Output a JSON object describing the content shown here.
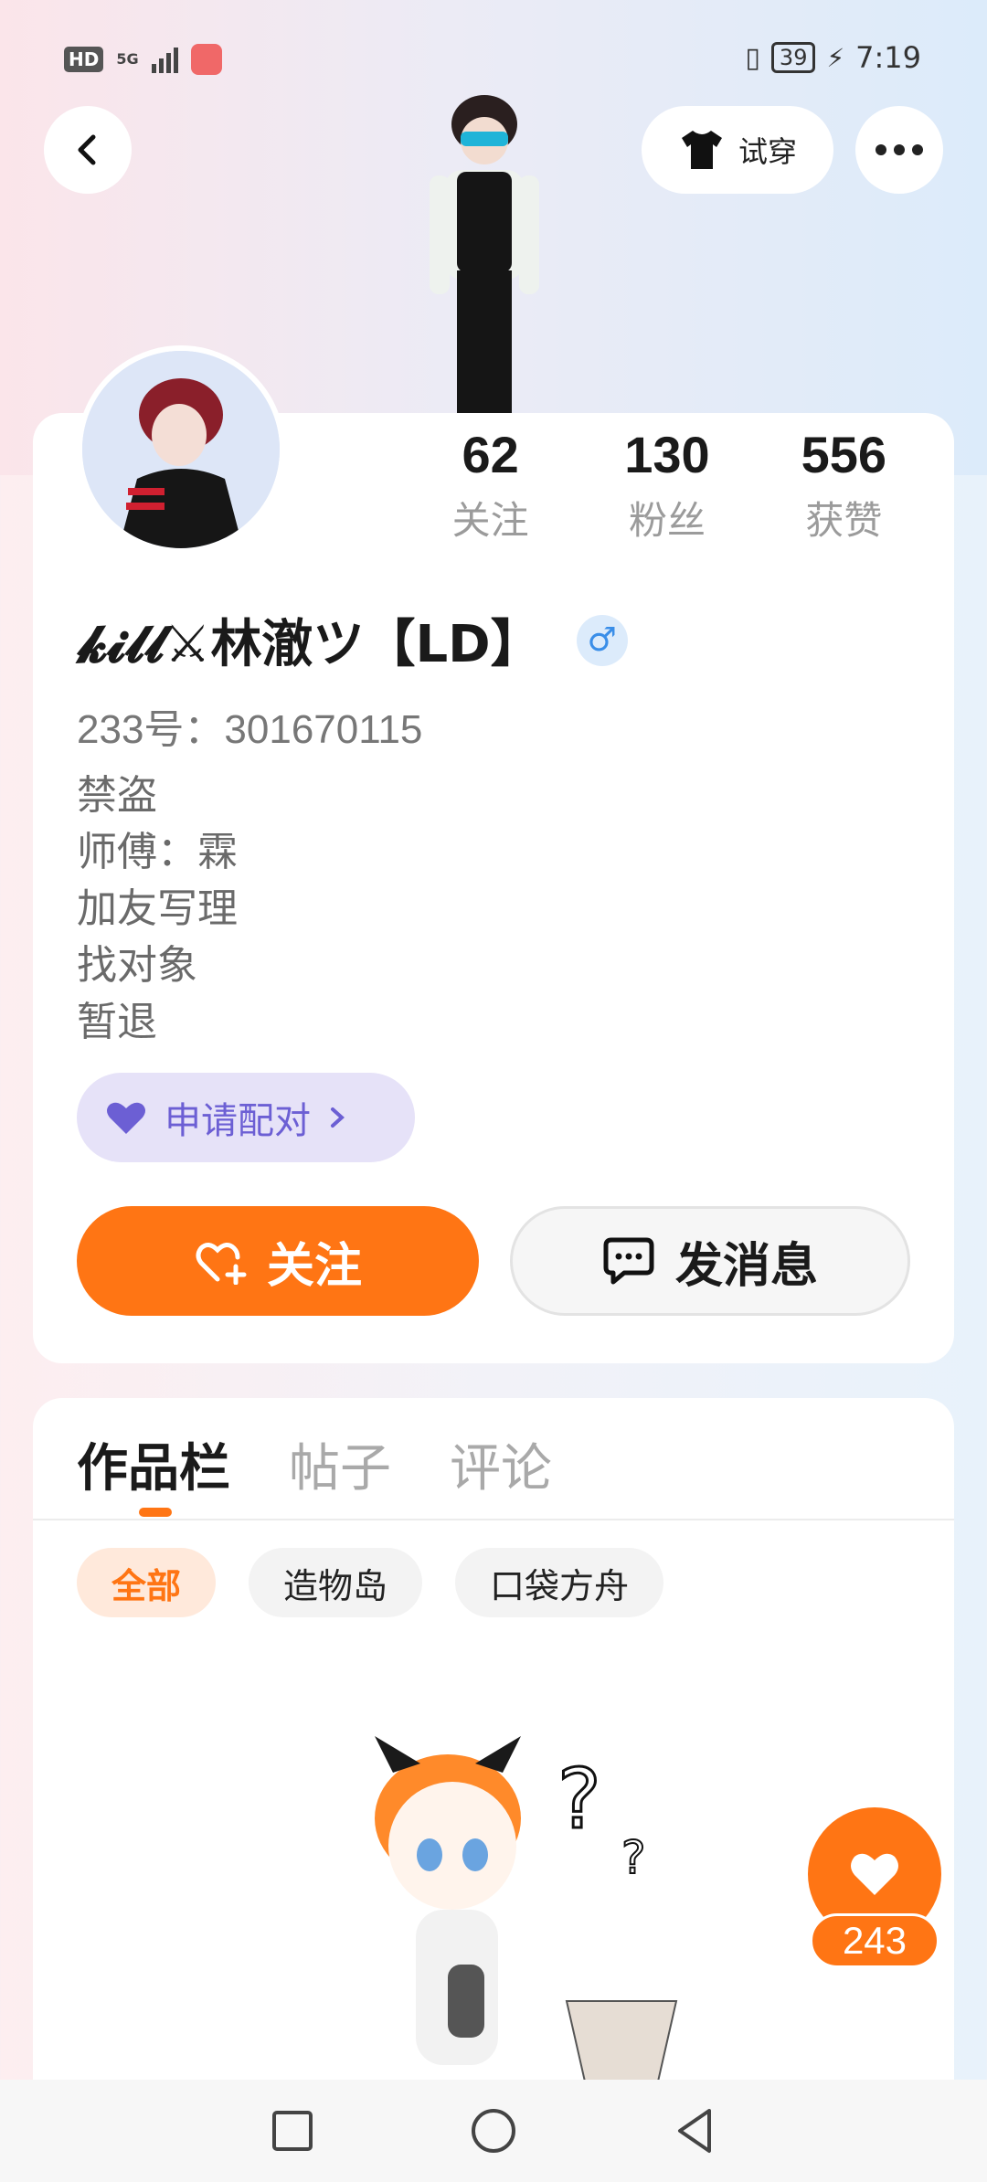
{
  "status_bar": {
    "hd": "HD",
    "network": "5G",
    "battery": "39",
    "time": "7:19"
  },
  "header": {
    "tryon_label": "试穿"
  },
  "profile": {
    "name": "𝓴𝓲𝓵𝓵⚔林澈ツ【LD】",
    "gender_symbol": "♂",
    "uid": "233号：301670115",
    "stats": [
      {
        "value": "62",
        "label": "关注"
      },
      {
        "value": "130",
        "label": "粉丝"
      },
      {
        "value": "556",
        "label": "获赞"
      }
    ],
    "bio": [
      "禁盗",
      "师傅：霖",
      "加友写理",
      "找对象",
      "暂退"
    ],
    "pair_label": "申请配对",
    "follow_label": "关注",
    "message_label": "发消息"
  },
  "works": {
    "tabs": [
      "作品栏",
      "帖子",
      "评论"
    ],
    "filters": [
      "全部",
      "造物岛",
      "口袋方舟"
    ]
  },
  "like_count": "243",
  "colors": {
    "accent": "#ff7514",
    "pair": "#6c5fd4",
    "male": "#3a8ee8"
  }
}
